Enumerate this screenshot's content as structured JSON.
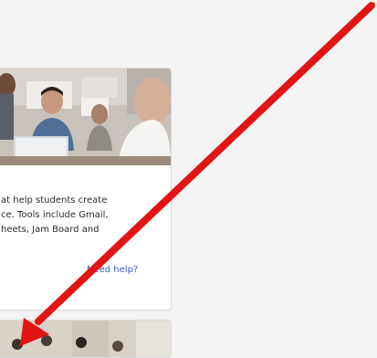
{
  "card": {
    "image_alt": "Students working on laptops in a classroom",
    "description": "at help students create\nce. Tools include Gmail,\nheets, Jam Board and",
    "help_link": "Need help?"
  },
  "next_card": {
    "image_alt": "Classroom photo"
  },
  "annotation": {
    "arrow_color": "#e21414"
  }
}
